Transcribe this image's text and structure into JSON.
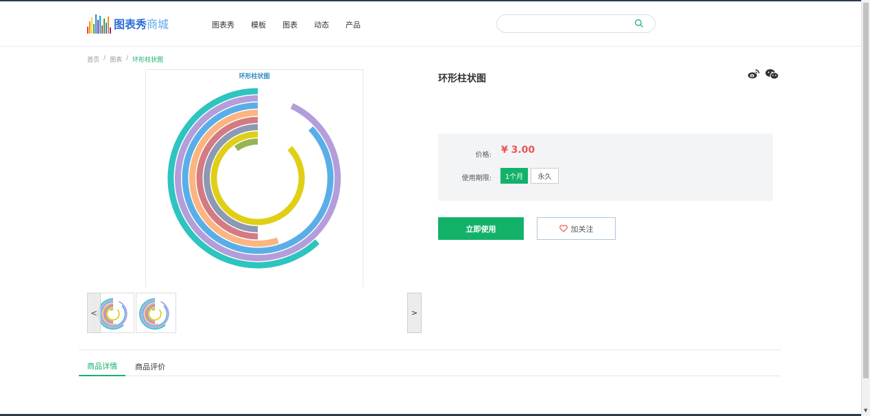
{
  "brand": {
    "name": "图表秀",
    "sub": "商城"
  },
  "nav": {
    "items": [
      "图表秀",
      "模板",
      "图表",
      "动态",
      "产品"
    ]
  },
  "search": {
    "placeholder": ""
  },
  "breadcrumb": {
    "items": [
      "首页",
      "图表",
      "环形柱状图"
    ],
    "separator": "/"
  },
  "preview": {
    "title": "环形柱状图",
    "rings": [
      {
        "color": "#2ec4c0",
        "fraction": 0.62
      },
      {
        "color": "#b39ddb",
        "fraction": 0.93
      },
      {
        "color": "#5aaee8",
        "fraction": 0.87
      },
      {
        "color": "#fbb580",
        "fraction": 0.55
      },
      {
        "color": "#d47a82",
        "fraction": 0.5
      },
      {
        "color": "#8d98b3",
        "fraction": 0.5
      },
      {
        "color": "#e0cf17",
        "fraction": 0.87
      },
      {
        "color": "#97b552",
        "fraction": 0.1
      }
    ]
  },
  "thumbs": {
    "prev": "<",
    "next": ">"
  },
  "product": {
    "title": "环形柱状图",
    "price_label": "价格:",
    "price": "¥ 3.00",
    "period_label": "使用期限:",
    "period_options": [
      "1个月",
      "永久"
    ],
    "selected_period": "1个月",
    "use_button": "立即使用",
    "fav_button": "加关注"
  },
  "tabs": {
    "items": [
      "商品详情",
      "商品评价"
    ],
    "active": "商品详情"
  },
  "colors": {
    "accent": "#13b26b",
    "price": "#f05352",
    "brand_blue": "#2a6fd6"
  }
}
